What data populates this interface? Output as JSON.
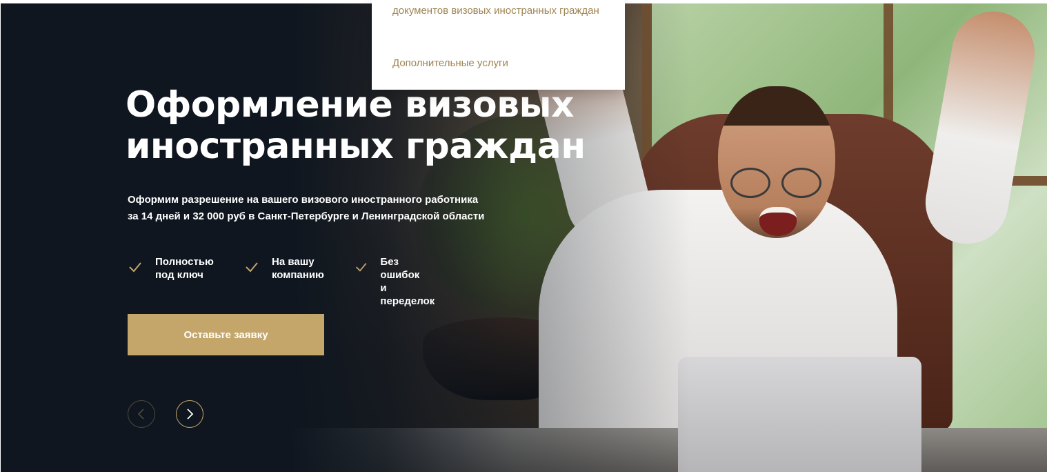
{
  "dropdown": {
    "item_1": "документов визовых иностранных граждан",
    "item_2": "Дополнительные услуги"
  },
  "hero": {
    "title_line_1": "Оформление визовых",
    "title_line_2": "иностранных граждан",
    "subtitle_line_1": "Оформим разрешение на вашего визового иностранного работника",
    "subtitle_line_2": "за 14 дней и 32 000 руб в Санкт-Петербурге и Ленинградской области",
    "features": [
      {
        "icon": "check-icon",
        "label": "Полностью\nпод ключ"
      },
      {
        "icon": "check-icon",
        "label": "На вашу\nкомпанию"
      },
      {
        "icon": "check-icon",
        "label": "Без ошибок\nи переделок"
      }
    ],
    "cta_label": "Оставьте заявку",
    "slider": {
      "prev_icon": "chevron-left-icon",
      "next_icon": "chevron-right-icon"
    }
  },
  "colors": {
    "accent": "#c4a66b",
    "dropdown_text": "#9e8350",
    "background": "#0f161f"
  }
}
